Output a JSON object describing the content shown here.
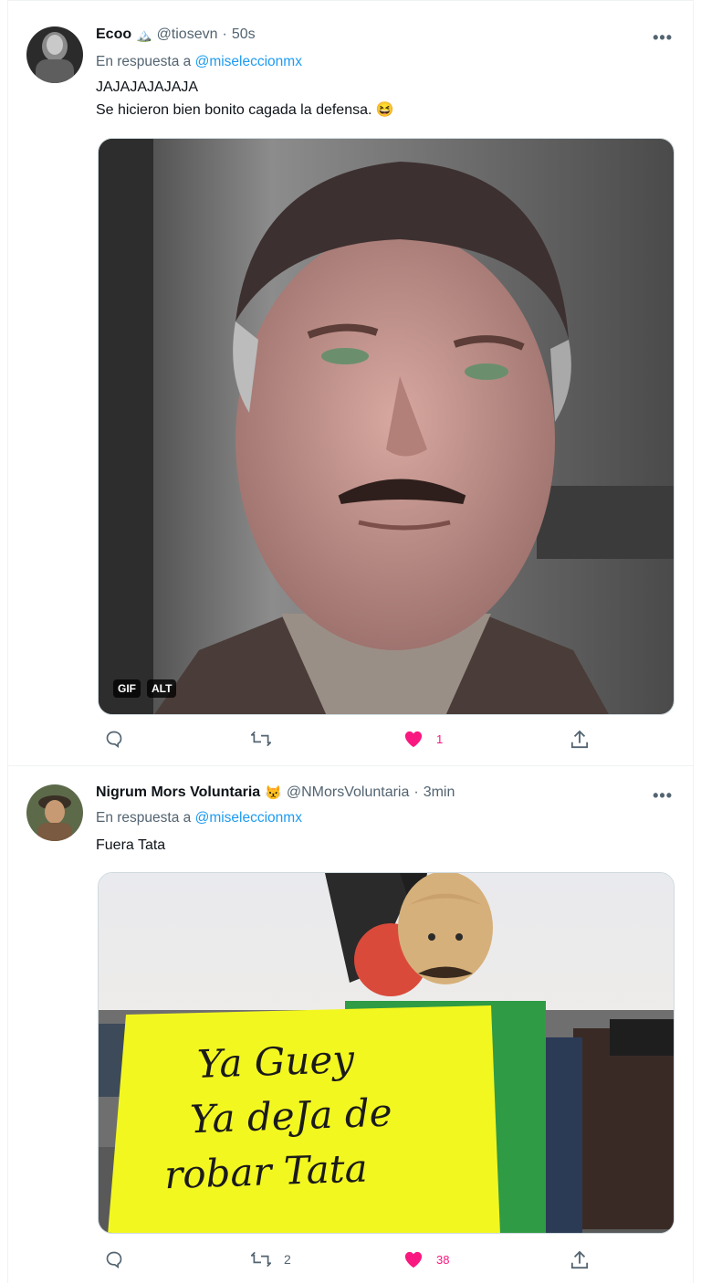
{
  "tweets": [
    {
      "name": "Ecoo",
      "handle": "@tiosevn",
      "time": "50s",
      "reply_prefix": "En respuesta a",
      "reply_to": "@miseleccionmx",
      "text_lines": [
        "JAJAJAJAJAJA",
        "Se hicieron bien bonito cagada la defensa. 😆"
      ],
      "media_badges": [
        "GIF",
        "ALT"
      ],
      "replies": "",
      "retweets": "",
      "likes": "1",
      "liked": true
    },
    {
      "name": "Nigrum Mors Voluntaria",
      "name_emoji": "😾",
      "handle": "@NMorsVoluntaria",
      "time": "3min",
      "reply_prefix": "En respuesta a",
      "reply_to": "@miseleccionmx",
      "text_lines": [
        "Fuera Tata"
      ],
      "sign_lines": [
        "Ya Guey",
        "Ya deJa de",
        "robar Tata"
      ],
      "replies": "",
      "retweets": "2",
      "likes": "38",
      "liked": true
    }
  ],
  "colors": {
    "accent": "#1d9bf0",
    "like": "#f91880",
    "muted": "#536471",
    "sign": "#f3f720"
  },
  "icons": [
    "reply-icon",
    "retweet-icon",
    "like-icon",
    "share-icon",
    "more-icon"
  ]
}
